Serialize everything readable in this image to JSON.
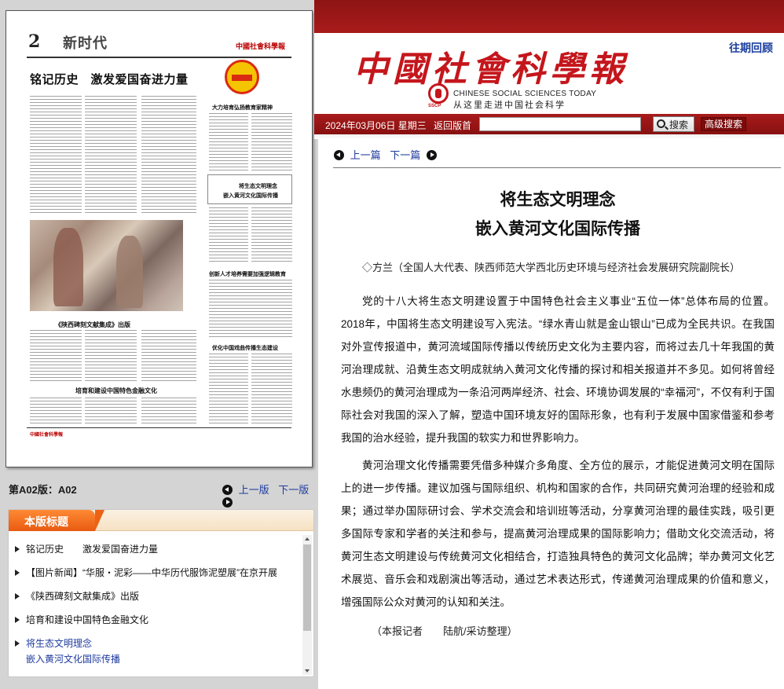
{
  "header": {
    "archive_link": "往期回顾",
    "brand_cn": "中國社會科學報",
    "brand_en": "CHINESE  SOCIAL  SCIENCES  TODAY",
    "brand_slogan": "从这里走进中国社会科学",
    "sscp": "SSCP",
    "date": "2024年03月06日 星期三",
    "back_home": "返回版首",
    "search_button": "搜索",
    "search_value": "",
    "advanced_search": "高级搜索"
  },
  "paper": {
    "page_number": "2",
    "section_name": "新时代",
    "masthead": "中國社會科學報",
    "main_headline": "铭记历史　激发爱国奋进力量",
    "subheads": [
      "大力培育弘扬教育家精神",
      "将生态文明理念",
      "嵌入黄河文化国际传播",
      "创新人才培养需要加强逻辑教育",
      "优化中国戏曲传播生态建设",
      "《陕西碑刻文献集成》出版",
      "培育和建设中国特色金融文化"
    ]
  },
  "page_label": "第A02版：A02",
  "page_nav": {
    "prev": "上一版",
    "next": "下一版"
  },
  "headlines": {
    "title": "本版标题",
    "items": [
      {
        "label": "铭记历史　　激发爱国奋进力量",
        "label2": ""
      },
      {
        "label": "【图片新闻】“华服・泥彩——中华历代服饰泥塑展”在京开展",
        "label2": ""
      },
      {
        "label": "《陕西碑刻文献集成》出版",
        "label2": ""
      },
      {
        "label": "培育和建设中国特色金融文化",
        "label2": ""
      },
      {
        "label": "将生态文明理念",
        "label2": "嵌入黄河文化国际传播"
      }
    ]
  },
  "article": {
    "nav_prev": "上一篇",
    "nav_next": "下一篇",
    "title_line1": "将生态文明理念",
    "title_line2": "嵌入黄河文化国际传播",
    "author": "◇方兰（全国人大代表、陕西师范大学西北历史环境与经济社会发展研究院副院长）",
    "paragraph1": "党的十八大将生态文明建设置于中国特色社会主义事业“五位一体”总体布局的位置。2018年，中国将生态文明建设写入宪法。“绿水青山就是金山银山”已成为全民共识。在我国对外宣传报道中，黄河流域国际传播以传统历史文化为主要内容，而将过去几十年我国的黄河治理成就、沿黄生态文明成就纳入黄河文化传播的探讨和相关报道并不多见。如何将曾经水患频仍的黄河治理成为一条沿河两岸经济、社会、环境协调发展的“幸福河”，不仅有利于国际社会对我国的深入了解，塑造中国环境友好的国际形象，也有利于发展中国家借鉴和参考我国的治水经验，提升我国的软实力和世界影响力。",
    "paragraph2": "黄河治理文化传播需要凭借多种媒介多角度、全方位的展示，才能促进黄河文明在国际上的进一步传播。建议加强与国际组织、机构和国家的合作，共同研究黄河治理的经验和成果；通过举办国际研讨会、学术交流会和培训班等活动，分享黄河治理的最佳实践，吸引更多国际专家和学者的关注和参与，提高黄河治理成果的国际影响力；借助文化交流活动，将黄河生态文明建设与传统黄河文化相结合，打造独具特色的黄河文化品牌；举办黄河文化艺术展览、音乐会和戏剧演出等活动，通过艺术表达形式，传递黄河治理成果的价值和意义，增强国际公众对黄河的认知和关注。",
    "credit": "（本报记者　　陆航/采访整理）"
  },
  "colors": {
    "brand_red": "#c4161c",
    "band_dark_red": "#8d1414",
    "link_blue": "#1e3a9e",
    "tab_orange": "#e85a10"
  }
}
